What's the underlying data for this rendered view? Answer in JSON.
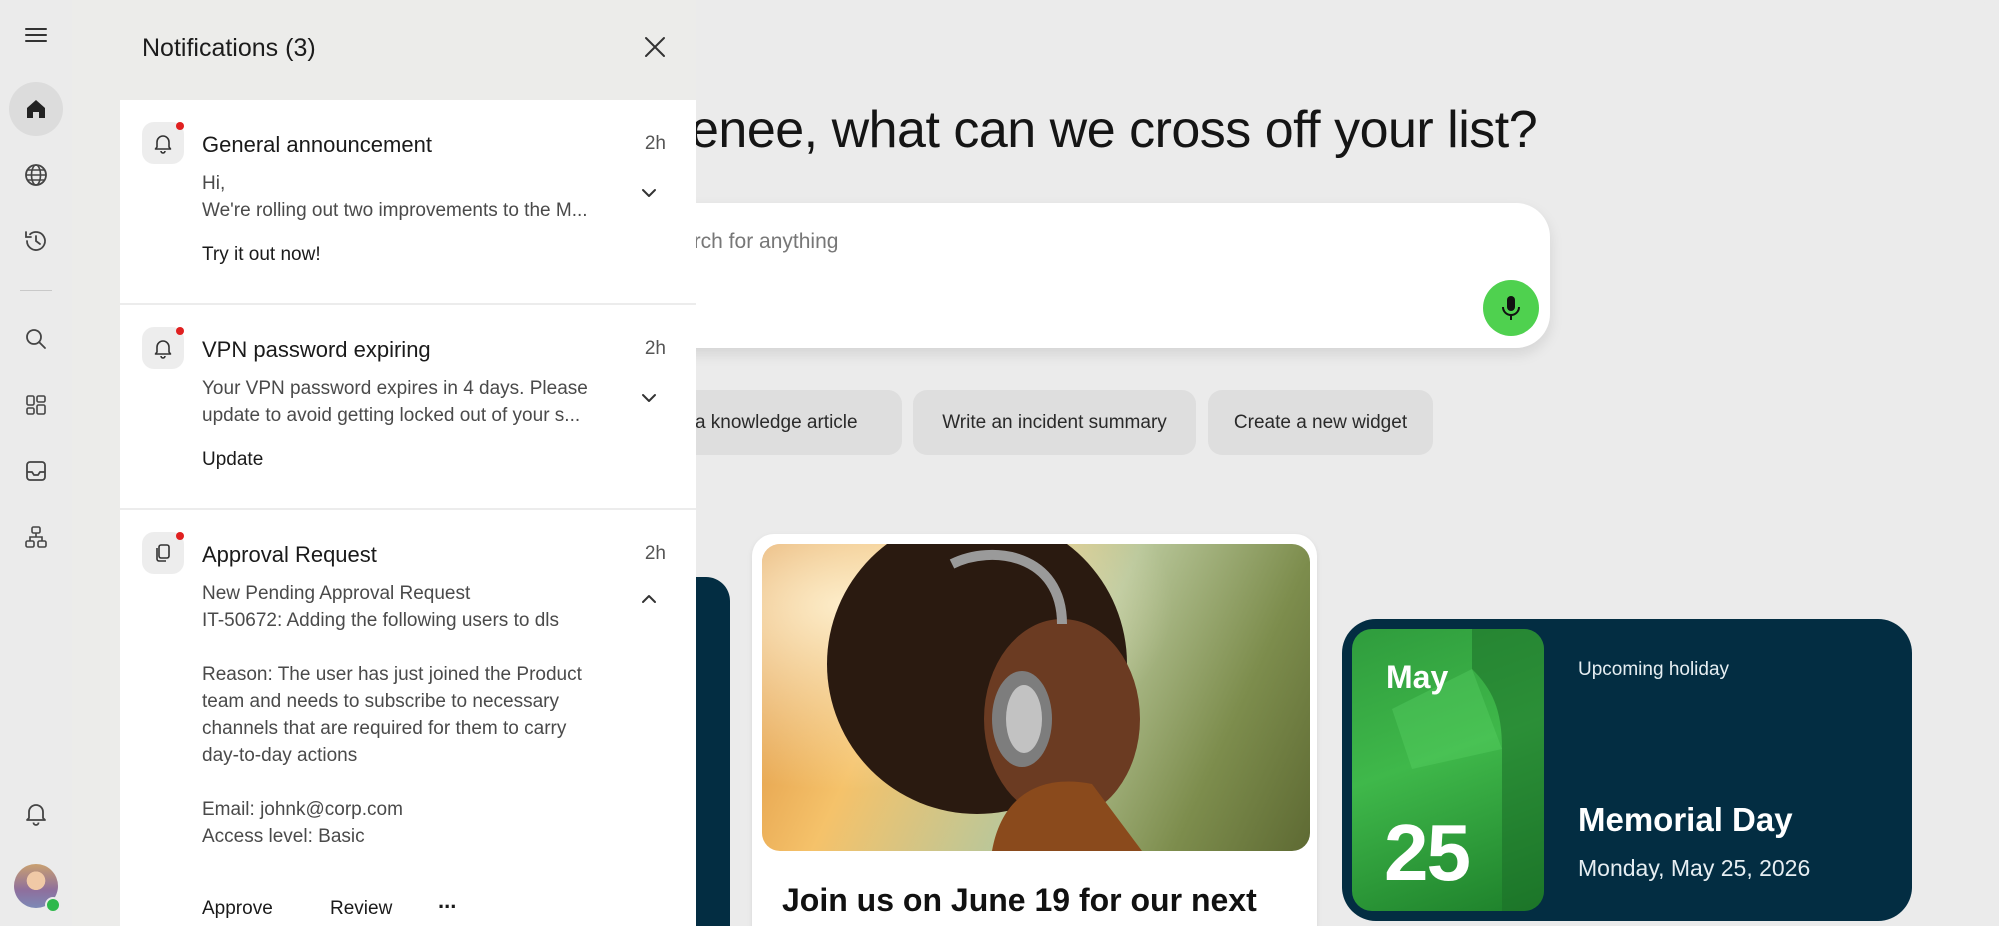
{
  "greeting": {
    "headline": "enee, what can we cross off your list?"
  },
  "search": {
    "placeholder": "arch for anything"
  },
  "suggestions": [
    {
      "label": "t a knowledge article"
    },
    {
      "label": "Write an incident summary"
    },
    {
      "label": "Create a new widget"
    }
  ],
  "event_card": {
    "title": "Join us on June 19 for our next"
  },
  "holiday_card": {
    "label": "Upcoming holiday",
    "month": "May",
    "day": "25",
    "name": "Memorial Day",
    "date": "Monday, May 25, 2026"
  },
  "notifications": {
    "title": "Notifications (3)",
    "items": [
      {
        "icon": "bell-icon",
        "title": "General announcement",
        "time": "2h",
        "lines": [
          "Hi,",
          "We're rolling out two improvements to the M..."
        ],
        "action": "Try it out now!"
      },
      {
        "icon": "bell-icon",
        "title": "VPN password expiring",
        "time": "2h",
        "lines": [
          "Your VPN password expires in 4 days. Please",
          "update to avoid getting locked out of your s..."
        ],
        "action": "Update"
      },
      {
        "icon": "document-icon",
        "title": "Approval Request",
        "time": "2h",
        "lines": [
          "New Pending Approval Request",
          "IT-50672: Adding the following users to dls",
          "",
          "Reason: The user has just joined the Product",
          "team and needs to subscribe to necessary",
          "channels that are required for them to carry",
          "day-to-day actions",
          "",
          "Email: johnk@corp.com",
          "Access level: Basic"
        ],
        "action": "Approve",
        "action_secondary": "Review",
        "more": "..."
      }
    ]
  },
  "colors": {
    "accent_green": "#4fd14f",
    "dark_navy": "#032d42",
    "unread_dot": "#e02020"
  }
}
